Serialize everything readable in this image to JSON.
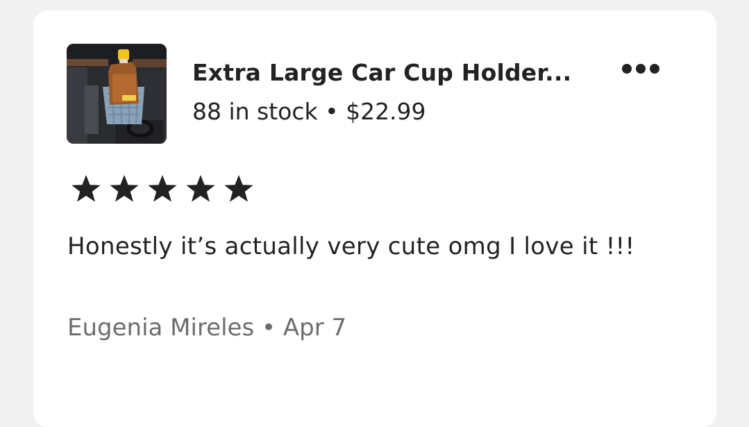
{
  "listing": {
    "title": "Extra Large Car Cup Holder...",
    "stock_price": "88 in stock • $22.99",
    "thumbnail": "product-photo-cup-holder-basket"
  },
  "menu": {
    "icon": "more-horizontal-icon"
  },
  "review": {
    "rating": 5,
    "rating_max": 5,
    "text": "Honestly it’s actually very cute omg I love it !!!",
    "byline": "Eugenia Mireles • Apr 7"
  },
  "colors": {
    "background": "#f1f1f1",
    "card": "#ffffff",
    "text_primary": "#222222",
    "text_secondary": "#6d6d6d"
  }
}
